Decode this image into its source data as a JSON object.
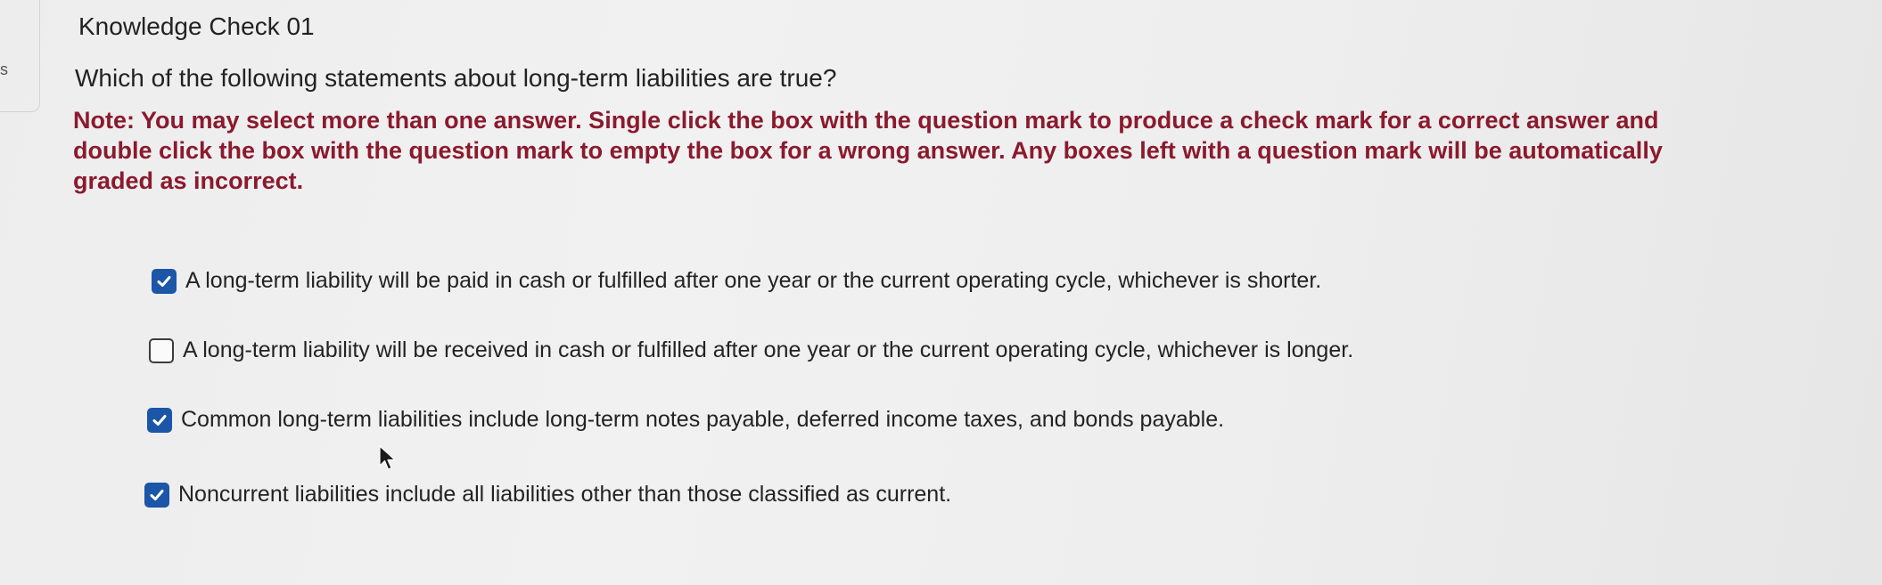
{
  "left_rail": {
    "glyph": "s"
  },
  "header": {
    "title": "Knowledge Check 01"
  },
  "question": {
    "prompt": "Which of the following statements about long-term liabilities are true?",
    "note": "Note: You may select more than one answer. Single click the box with the question mark to produce a check mark for a correct answer and double click the box with the question mark to empty the box for a wrong answer. Any boxes left with a question mark will be automatically graded as incorrect."
  },
  "options": [
    {
      "text": "A long-term liability will be paid in cash or fulfilled after one year or the current operating cycle, whichever is shorter.",
      "checked": true
    },
    {
      "text": "A long-term liability will be received in cash or fulfilled after one year or the current operating cycle, whichever is longer.",
      "checked": false
    },
    {
      "text": "Common long-term liabilities include long-term notes payable, deferred income taxes, and bonds payable.",
      "checked": true
    },
    {
      "text": "Noncurrent liabilities include all liabilities other than those classified as current.",
      "checked": true
    }
  ],
  "colors": {
    "note_text": "#8b1a2e",
    "checkbox_checked": "#1b56a8",
    "checkbox_border": "#3c3c3c"
  },
  "icons": {
    "checked": "checkmark-icon",
    "cursor": "mouse-pointer-icon"
  }
}
